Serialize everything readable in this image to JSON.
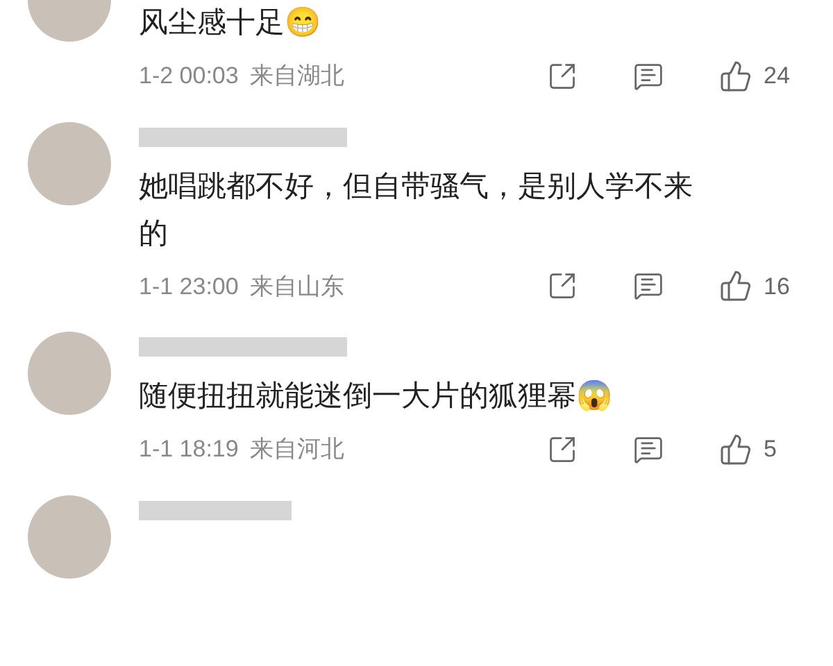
{
  "comments": [
    {
      "text": "风尘感十足😁",
      "time": "1-2 00:03",
      "location": "来自湖北",
      "likes": "24"
    },
    {
      "text": "她唱跳都不好，但自带骚气，是别人学不来的",
      "time": "1-1 23:00",
      "location": "来自山东",
      "likes": "16"
    },
    {
      "text": "随便扭扭就能迷倒一大片的狐狸幂😱",
      "time": "1-1 18:19",
      "location": "来自河北",
      "likes": "5"
    }
  ]
}
